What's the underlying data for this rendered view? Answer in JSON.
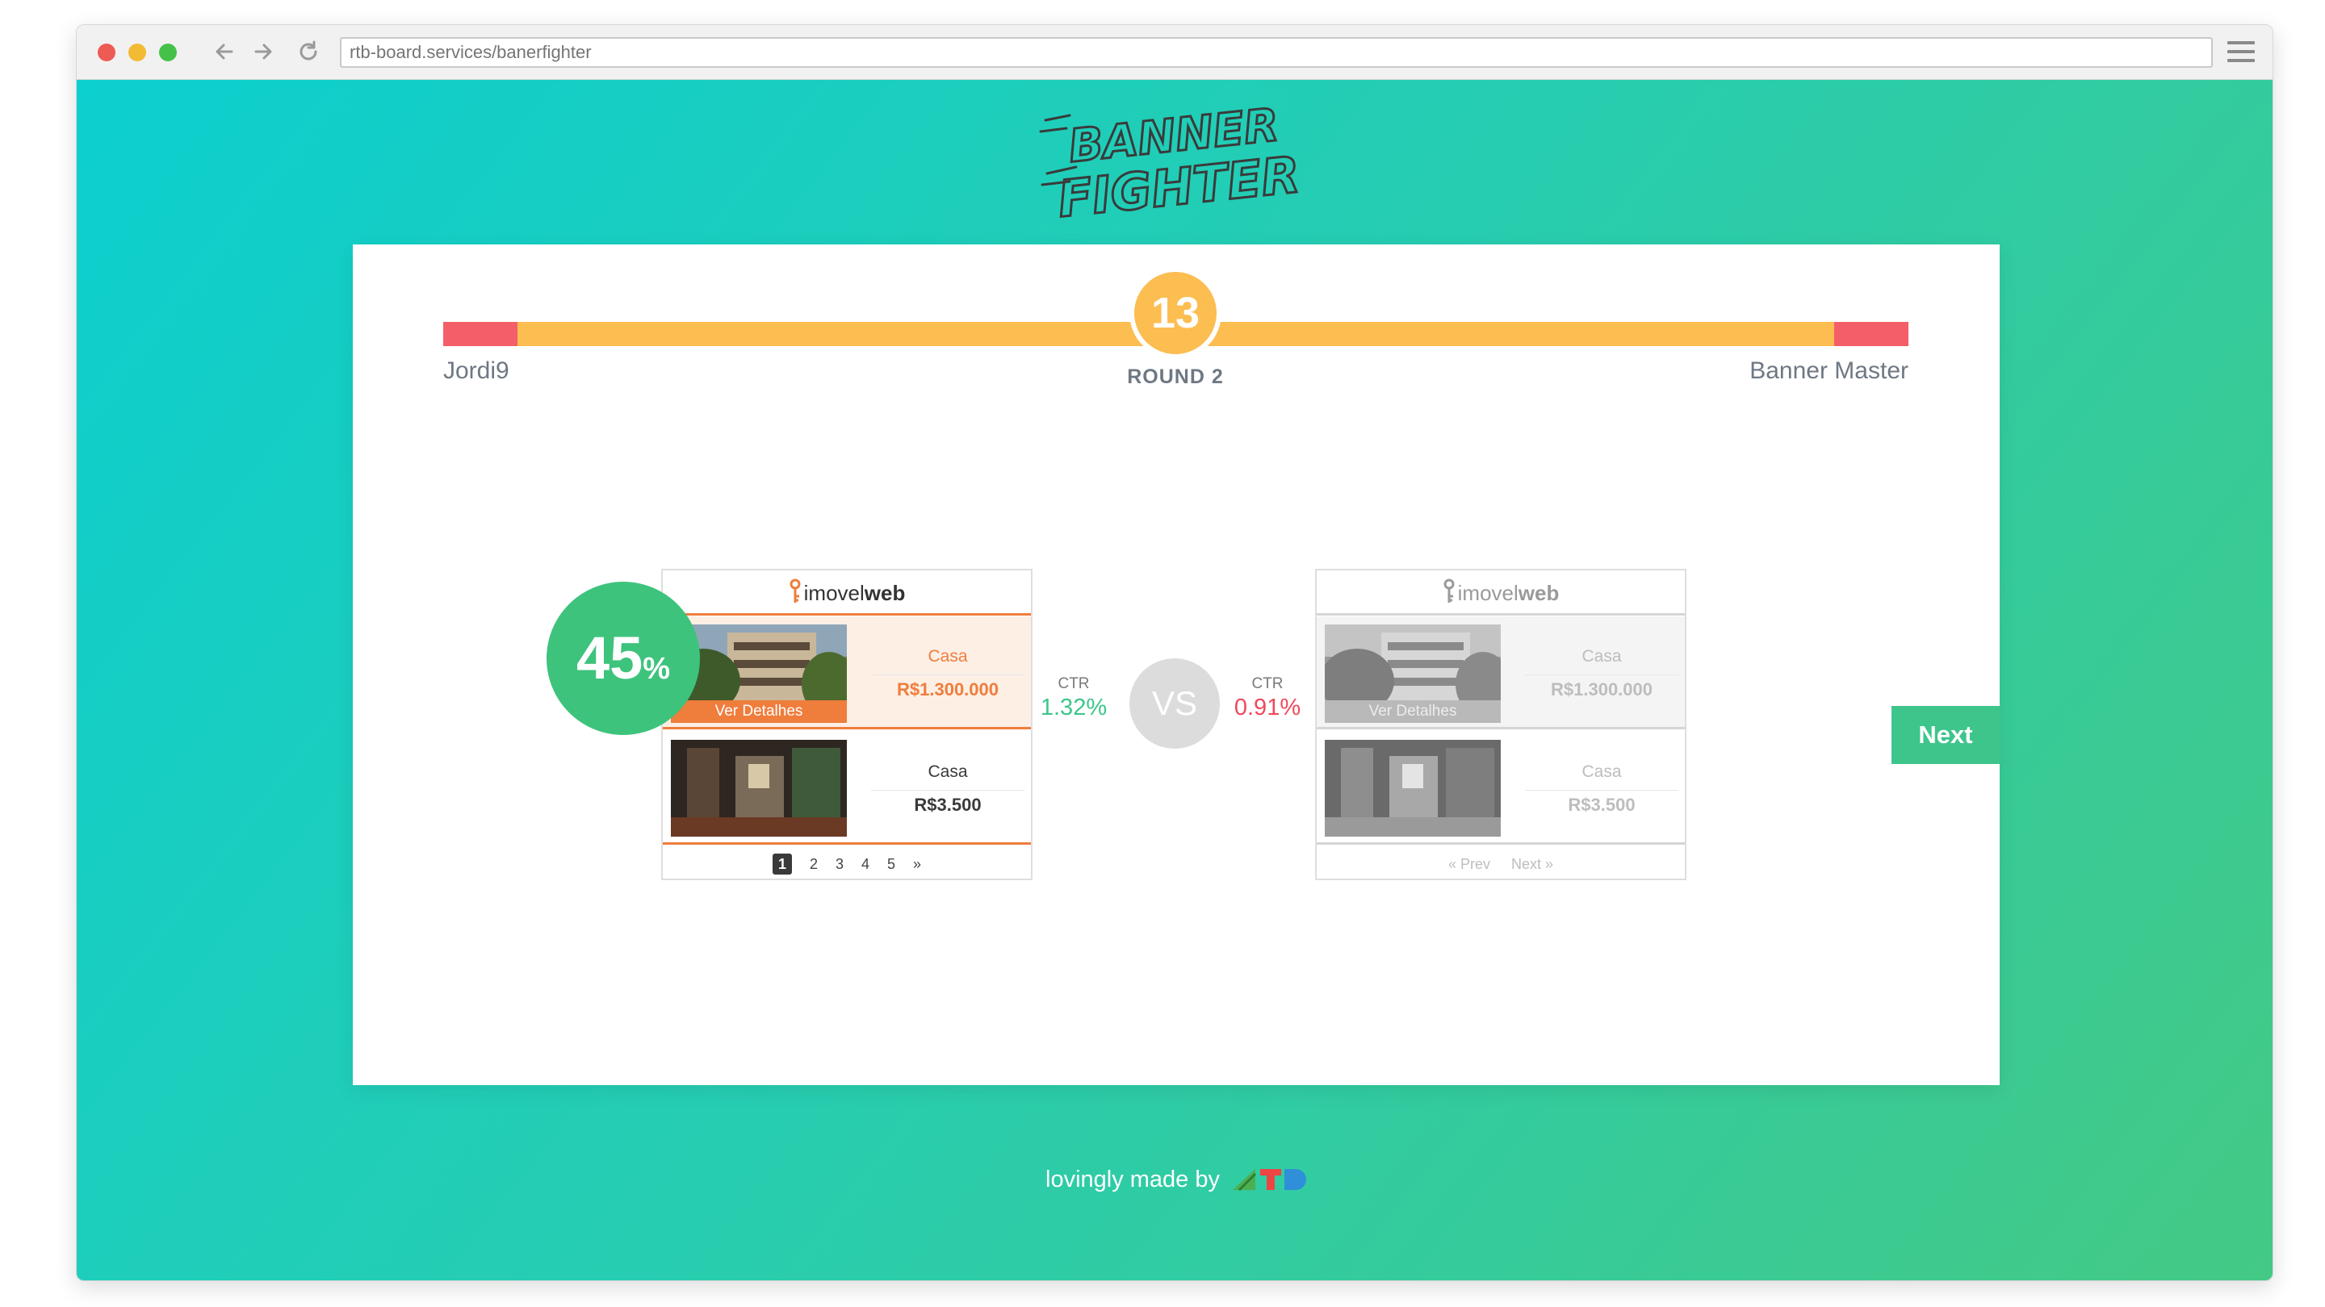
{
  "browser": {
    "url": "rtb-board.services/banerfighter"
  },
  "app": {
    "logo_text_line1": "BANNER",
    "logo_text_line2": "FIGHTER"
  },
  "match": {
    "round_number": "13",
    "round_label": "ROUND 2",
    "player_left": "Jordi9",
    "player_right": "Banner Master",
    "health_left_fraction": 0.05,
    "health_right_fraction": 0.05
  },
  "fight": {
    "win_percent_value": "45",
    "win_percent_sign": "%",
    "vs_label": "VS",
    "ctr_left_label": "CTR",
    "ctr_left_value": "1.32%",
    "ctr_right_label": "CTR",
    "ctr_right_value": "0.91%",
    "next_label": "Next"
  },
  "banner_left": {
    "brand_light": "imovel",
    "brand_bold": "web",
    "listings": [
      {
        "button": "Ver Detalhes",
        "type": "Casa",
        "price": "R$1.300.000"
      },
      {
        "type": "Casa",
        "price": "R$3.500"
      }
    ],
    "pages": [
      "1",
      "2",
      "3",
      "4",
      "5",
      "»"
    ]
  },
  "banner_right": {
    "brand_light": "imovel",
    "brand_bold": "web",
    "listings": [
      {
        "button": "Ver Detalhes",
        "type": "Casa",
        "price": "R$1.300.000"
      },
      {
        "type": "Casa",
        "price": "R$3.500"
      }
    ],
    "prev": "« Prev",
    "next": "Next »"
  },
  "footer": {
    "text": "lovingly made by"
  },
  "colors": {
    "accent_orange": "#fcbd51",
    "health_red": "#f45e69",
    "winner_green": "#3ec37d",
    "ctr_positive": "#3ec58b",
    "ctr_negative": "#f0495d",
    "brand_orange": "#ef7d3c"
  }
}
